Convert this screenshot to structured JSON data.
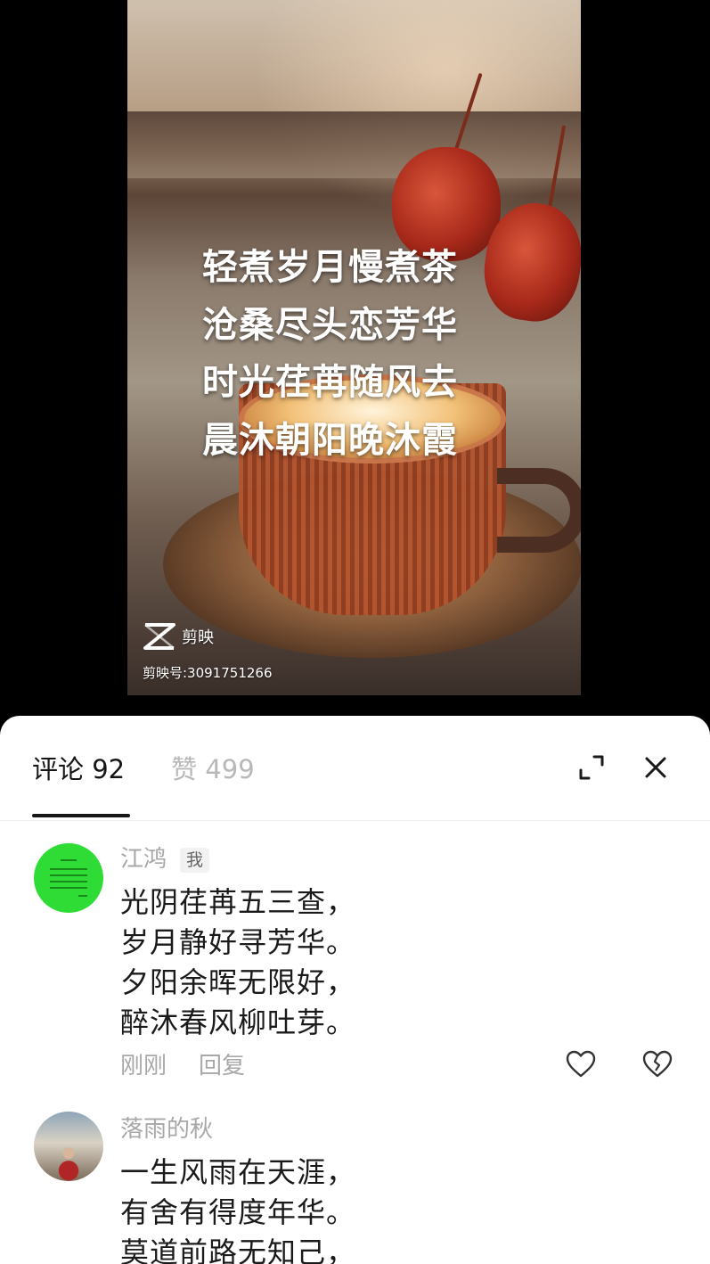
{
  "video": {
    "poem_lines": [
      "轻煮岁月慢煮茶",
      "沧桑尽头恋芳华",
      "时光荏苒随风去",
      "晨沐朝阳晚沐霞"
    ],
    "watermark_app": "剪映",
    "watermark_id": "剪映号:3091751266"
  },
  "sheet": {
    "tabs": [
      {
        "label": "评论 92",
        "active": true
      },
      {
        "label": "赞 499",
        "active": false
      }
    ],
    "expand_icon": "expand-icon",
    "close_icon": "close-icon"
  },
  "comments": [
    {
      "avatar": "green-text-avatar",
      "name": "江鸿",
      "badge": "我",
      "lines": [
        "光阴荏苒五三查，",
        "岁月静好寻芳华。",
        "夕阳余晖无限好，",
        "醉沐春风柳吐芽。"
      ],
      "time": "刚刚",
      "reply_label": "回复",
      "like_icon": "heart-icon",
      "dislike_icon": "broken-heart-icon"
    },
    {
      "avatar": "photo-avatar",
      "name": "落雨的秋",
      "lines": [
        "一生风雨在天涯，",
        "有舍有得度年华。",
        "莫道前路无知己，"
      ]
    }
  ]
}
